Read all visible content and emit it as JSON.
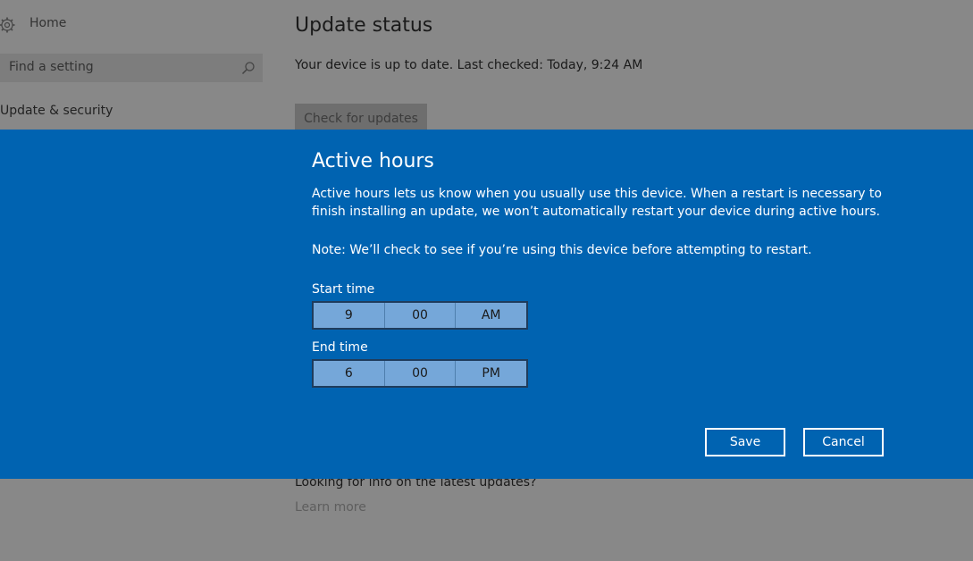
{
  "sidebar": {
    "home_label": "Home",
    "search_placeholder": "Find a setting",
    "nav_item": "Update & security"
  },
  "main": {
    "title": "Update status",
    "status": "Your device is up to date. Last checked: Today, 9:24 AM",
    "check_button": "Check for updates",
    "info_text": "Looking for info on the latest updates?",
    "learn_more": "Learn more"
  },
  "dialog": {
    "title": "Active hours",
    "description": "Active hours lets us know when you usually use this device. When a restart is necessary to finish installing an update, we won’t automatically restart your device during active hours.",
    "note": "Note: We’ll check to see if you’re using this device before attempting to restart.",
    "start_time": {
      "label": "Start time",
      "hour": "9",
      "minute": "00",
      "period": "AM"
    },
    "end_time": {
      "label": "End time",
      "hour": "6",
      "minute": "00",
      "period": "PM"
    },
    "save_label": "Save",
    "cancel_label": "Cancel"
  },
  "colors": {
    "dialog_background": "#0063b1",
    "dimmed_background": "#888888",
    "picker_fill": "#75a7d9"
  },
  "icons": {
    "home": "gear-icon",
    "search": "search-icon"
  }
}
